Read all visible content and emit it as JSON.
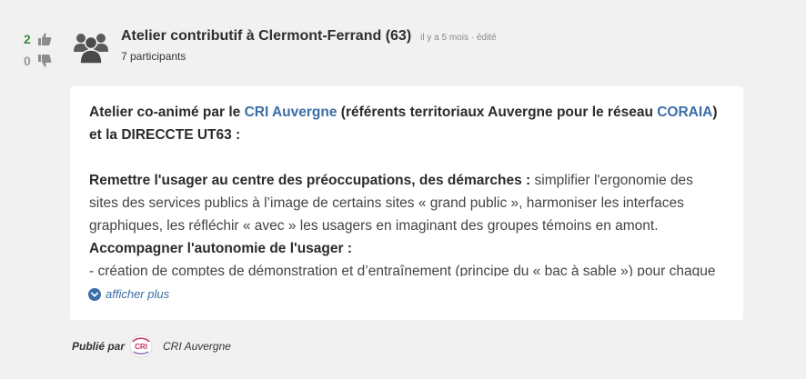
{
  "votes": {
    "up_count": "2",
    "down_count": "0"
  },
  "post": {
    "title": "Atelier contributif à Clermont-Ferrand (63)",
    "meta": "il y a 5 mois · édité",
    "participants": "7 participants"
  },
  "content": {
    "p1_a": "Atelier co-animé par le ",
    "p1_link1": "CRI Auvergne",
    "p1_b": " (référents territoriaux Auvergne pour le réseau ",
    "p1_link2": "CORAIA",
    "p1_c": ") et la DIRECCTE UT63 :",
    "p2_bold": "Remettre l'usager au centre des préoccupations, des démarches :",
    "p2_text": " simplifier l'ergonomie des sites des services publics à l’image de certains sites « grand public », harmoniser les interfaces graphiques, les réfléchir « avec » les usagers en imaginant des groupes témoins en amont.",
    "p3_bold": "Accompagner l'autonomie de l'usager :",
    "p4_text": "- création de comptes de démonstration et d’entraînement (principe du « bac à sable ») pour chaque"
  },
  "show_more": {
    "label": "afficher plus"
  },
  "footer": {
    "published_by": "Publié par",
    "logo_text": "CRI",
    "author": "CRI Auvergne"
  },
  "colors": {
    "vote_up": "#3c8d3c",
    "link": "#3b6ea5",
    "background": "#f1f1f1",
    "card": "#ffffff"
  }
}
